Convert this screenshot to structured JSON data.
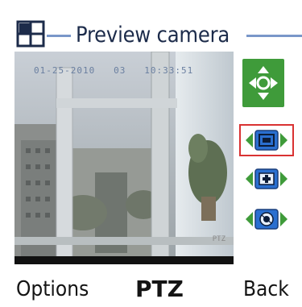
{
  "window": {
    "title": "Preview camera"
  },
  "video": {
    "osd_timestamp": "01-25-2010   03   10:33:51",
    "watermark": "PTZ"
  },
  "controls": {
    "move": {
      "icon": "pan-tilt-arrows-icon"
    },
    "focus": {
      "icon": "focus-frame-icon",
      "selected": true
    },
    "zoom": {
      "icon": "zoom-plus-icon"
    },
    "iris": {
      "icon": "iris-aperture-icon"
    }
  },
  "softkeys": {
    "left": "Options",
    "middle": "PTZ",
    "right": "Back"
  },
  "colors": {
    "accent_green": "#3f9b3a",
    "selection_red": "#d93232",
    "title_line": "#7a97c9"
  }
}
